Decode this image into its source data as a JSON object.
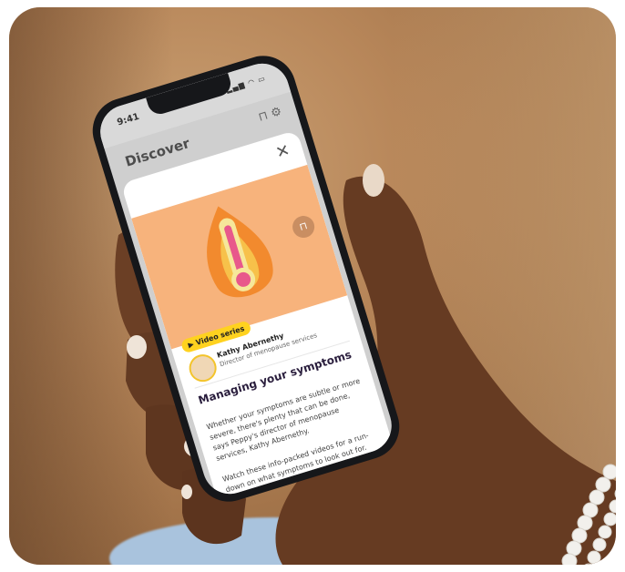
{
  "phone": {
    "status_time": "9:41",
    "status_icons": "signal wifi battery",
    "app_title": "Discover",
    "header_icons": [
      "bookmark-icon",
      "gear-icon"
    ],
    "close_icon": "close-icon",
    "hero_icon": "thermometer-flame-icon",
    "hero_color": "#f7b37c",
    "bookmark_icon": "bookmark-icon",
    "badge_label": "Video series",
    "badge_color": "#ffd21f",
    "author_name": "Kathy Abernethy",
    "author_role": "Director of menopause services",
    "heading": "Managing your symptoms",
    "paragraph1": "Whether your symptoms are subtle or more severe, there's plenty that can be done, says Peppy's director of menopause services, Kathy Abernethy.",
    "paragraph2": "Watch these info-packed videos for a run-down on what symptoms to look out for. Find your symptom/s in alphabetical order."
  }
}
